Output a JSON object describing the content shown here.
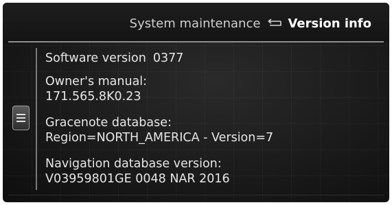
{
  "header": {
    "parent": "System maintenance",
    "back_icon": "back-arrow-icon",
    "current": "Version info"
  },
  "side_handle": {
    "icon": "menu-lines-icon"
  },
  "software": {
    "label": "Software version",
    "value": "0377"
  },
  "owners_manual": {
    "label": "Owner's manual:",
    "value": "171.565.8K0.23"
  },
  "gracenote": {
    "label": "Gracenote database:",
    "value": "Region=NORTH_AMERICA - Version=7"
  },
  "navigation": {
    "label": "Navigation database version:",
    "value": "V03959801GE 0048 NAR 2016"
  }
}
